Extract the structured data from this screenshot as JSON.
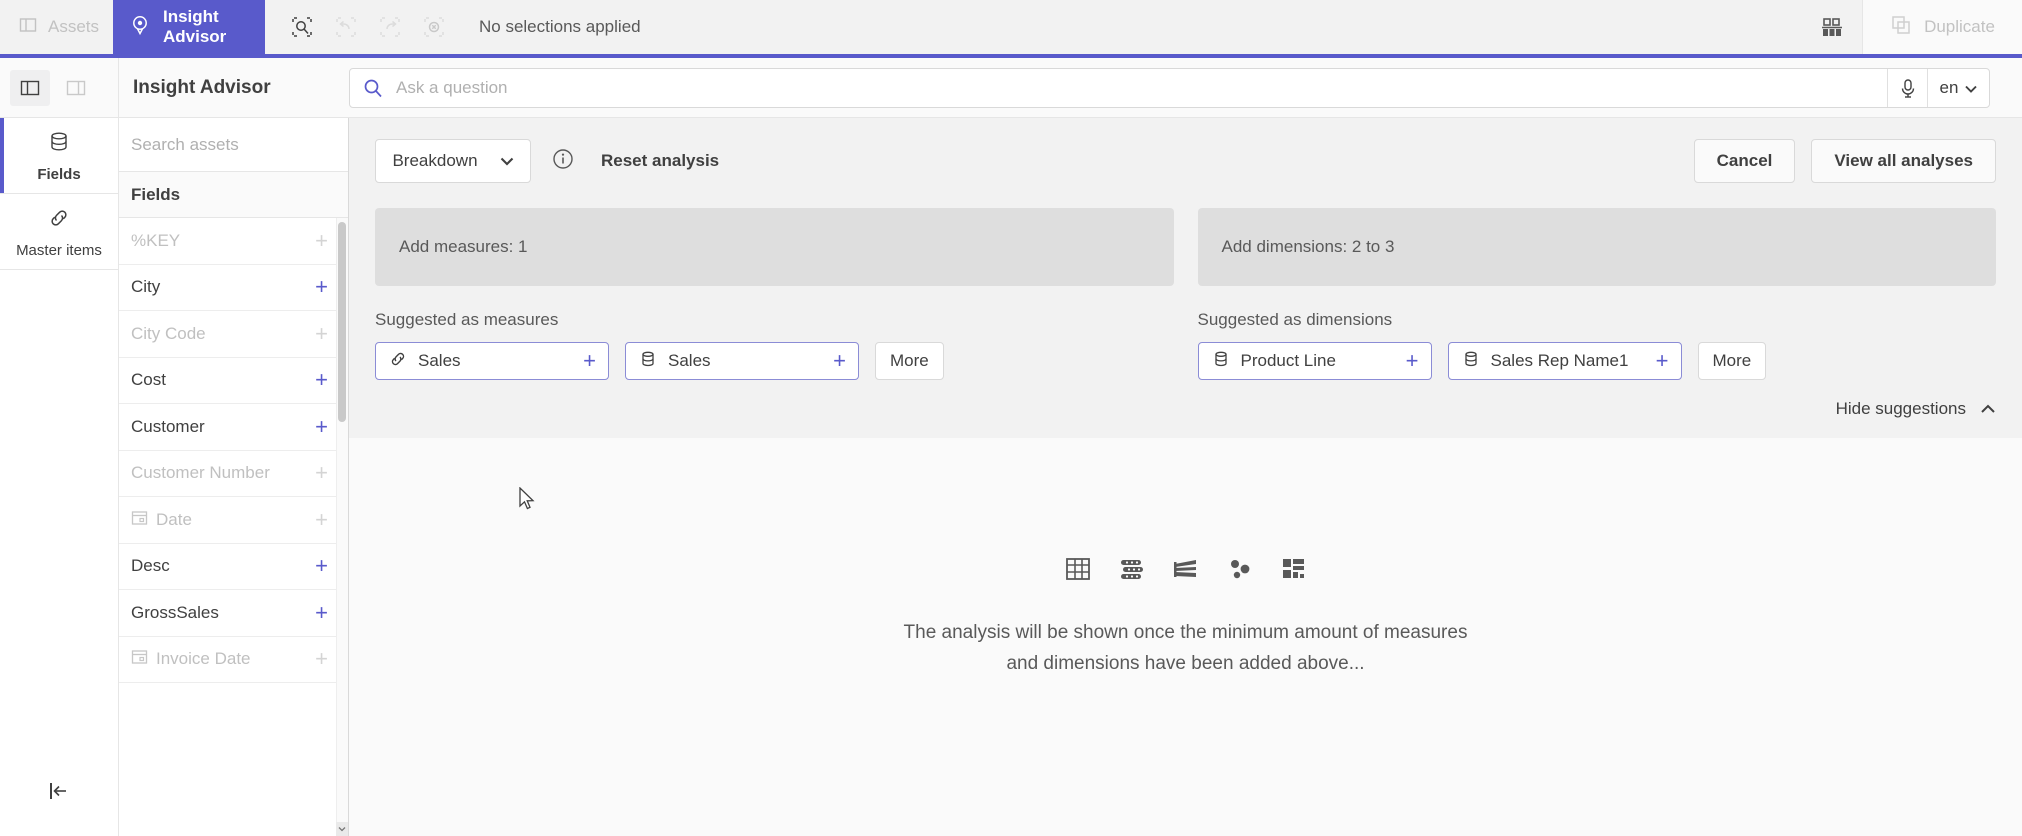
{
  "topbar": {
    "assets_label": "Assets",
    "insight_advisor_label": "Insight Advisor",
    "selection_message": "No selections applied",
    "duplicate_label": "Duplicate",
    "icons": {
      "assets": "panel-icon",
      "insight": "lightbulb-pin-icon",
      "smart_search": "smart-search-icon",
      "undo": "undo-icon",
      "redo": "redo-icon",
      "clear": "clear-selections-icon",
      "chart": "chart-icon",
      "duplicate": "duplicate-icon"
    }
  },
  "secondbar": {
    "title": "Insight Advisor",
    "toggle_left": "left-panel-toggle",
    "toggle_right": "right-panel-toggle",
    "search": {
      "placeholder": "Ask a question",
      "value": ""
    },
    "language": "en"
  },
  "rail": {
    "items": [
      {
        "label": "Fields",
        "icon": "database-icon",
        "active": true
      },
      {
        "label": "Master items",
        "icon": "link-icon",
        "active": false
      }
    ],
    "collapse_label": "collapse-rail-icon"
  },
  "assets": {
    "search_placeholder": "Search assets",
    "section_header": "Fields",
    "fields": [
      {
        "label": "%KEY",
        "dimmed": true,
        "icon": ""
      },
      {
        "label": "City",
        "dimmed": false,
        "icon": ""
      },
      {
        "label": "City Code",
        "dimmed": true,
        "icon": ""
      },
      {
        "label": "Cost",
        "dimmed": false,
        "icon": ""
      },
      {
        "label": "Customer",
        "dimmed": false,
        "icon": ""
      },
      {
        "label": "Customer Number",
        "dimmed": true,
        "icon": ""
      },
      {
        "label": "Date",
        "dimmed": true,
        "icon": "calendar-icon"
      },
      {
        "label": "Desc",
        "dimmed": false,
        "icon": ""
      },
      {
        "label": "GrossSales",
        "dimmed": false,
        "icon": ""
      },
      {
        "label": "Invoice Date",
        "dimmed": true,
        "icon": "calendar-icon"
      }
    ],
    "add_symbol": "+"
  },
  "analysis": {
    "breakdown_label": "Breakdown",
    "info_icon": "info-icon",
    "reset_label": "Reset analysis",
    "cancel_label": "Cancel",
    "view_all_label": "View all analyses",
    "measures_dropzone": "Add measures: 1",
    "dimensions_dropzone": "Add dimensions: 2 to 3",
    "suggested_measures_label": "Suggested as measures",
    "suggested_dimensions_label": "Suggested as dimensions",
    "suggested_measures": [
      {
        "label": "Sales",
        "icon": "link-icon"
      },
      {
        "label": "Sales",
        "icon": "database-icon"
      }
    ],
    "suggested_dimensions": [
      {
        "label": "Product Line",
        "icon": "database-icon"
      },
      {
        "label": "Sales Rep Name1",
        "icon": "database-icon"
      }
    ],
    "more_label": "More",
    "hide_suggestions_label": "Hide suggestions",
    "empty_line1": "The analysis will be shown once the minimum amount of measures",
    "empty_line2": "and dimensions have been added above...",
    "viz_icons": [
      "table-icon",
      "bar-stacked-icon",
      "sankey-icon",
      "scatter-icon",
      "treemap-icon"
    ]
  },
  "colors": {
    "accent": "#595acb",
    "chip_border": "#8b8cd6",
    "topbar_bg": "#f2f2f2",
    "dropzone_bg": "#dedede",
    "text": "#404040",
    "muted": "#595959",
    "disabled": "#c2c2c2"
  }
}
